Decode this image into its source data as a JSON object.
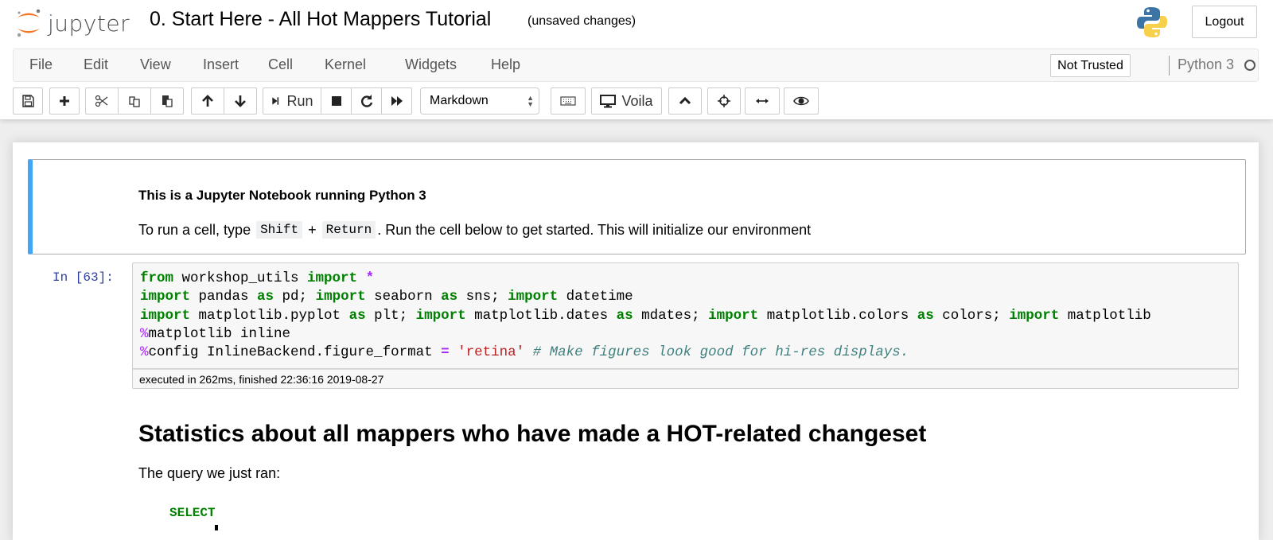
{
  "header": {
    "logo_text": "jupyter",
    "notebook_title": "0. Start Here - All Hot Mappers Tutorial",
    "save_status": "(unsaved changes)",
    "logout_label": "Logout"
  },
  "menubar": {
    "items": [
      "File",
      "Edit",
      "View",
      "Insert",
      "Cell",
      "Kernel",
      "Widgets",
      "Help"
    ],
    "trust_label": "Not Trusted",
    "kernel_name": "Python 3",
    "kernel_status": "idle"
  },
  "toolbar": {
    "run_label": "Run",
    "cell_type": "Markdown",
    "voila_label": "Voila",
    "icons": [
      "save-icon",
      "plus-icon",
      "cut-icon",
      "copy-icon",
      "paste-icon",
      "arrow-up-icon",
      "arrow-down-icon",
      "step-forward-icon",
      "stop-icon",
      "restart-icon",
      "fast-forward-icon",
      "keyboard-icon",
      "desktop-icon",
      "chevron-up-icon",
      "crosshairs-icon",
      "arrows-h-icon",
      "eye-icon"
    ]
  },
  "cells": {
    "intro": {
      "heading": "This is a Jupyter Notebook running Python 3",
      "text_before": "To run a cell, type ",
      "key1": "Shift",
      "plus": " + ",
      "key2": "Return",
      "text_after": ". Run the cell below to get started. This will initialize our environment"
    },
    "code": {
      "prompt": "In [63]:",
      "lines": [
        "from workshop_utils import *",
        "import pandas as pd; import seaborn as sns; import datetime",
        "import matplotlib.pyplot as plt; import matplotlib.dates as mdates; import matplotlib.colors as colors; import matplotlib",
        "%matplotlib inline",
        "%config InlineBackend.figure_format = 'retina' # Make figures look good for hi-res displays."
      ],
      "exec_info": "executed in 262ms, finished 22:36:16 2019-08-27"
    },
    "stats": {
      "heading": "Statistics about all mappers who have made a HOT-related changeset",
      "text": "The query we just ran:",
      "sql_first": "SELECT"
    }
  },
  "colors": {
    "selected_cell_accent": "#42a5f5",
    "prompt": "#303f9f",
    "keyword": "#008000",
    "string": "#ba2121",
    "comment": "#408080",
    "magic": "#aa22ff",
    "logo_orange": "#f37726"
  }
}
